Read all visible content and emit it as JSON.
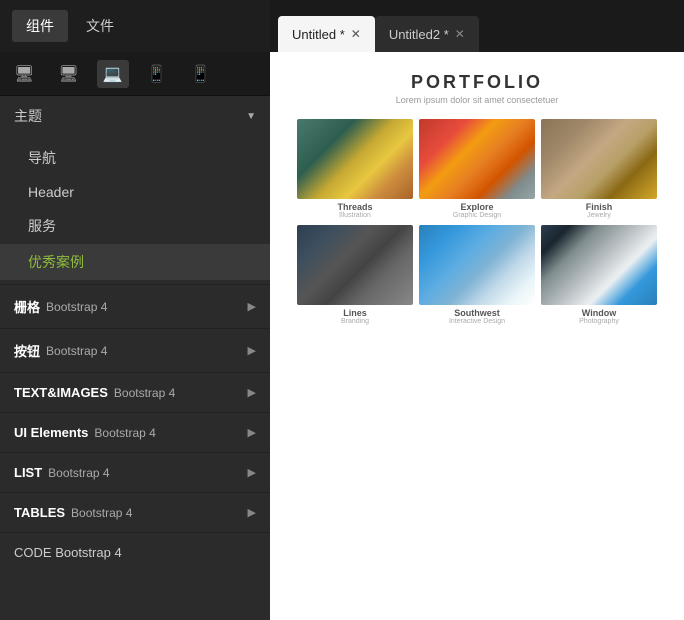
{
  "topTabs": {
    "tab1": {
      "label": "组件",
      "active": true
    },
    "tab2": {
      "label": "文件",
      "active": false
    }
  },
  "documentTabs": [
    {
      "id": "untitled1",
      "label": "Untitled",
      "modified": true,
      "active": true
    },
    {
      "id": "untitled2",
      "label": "Untitled2",
      "modified": true,
      "active": false
    }
  ],
  "toolbar": {
    "icons": [
      "desktop",
      "monitor",
      "laptop",
      "tablet",
      "phone"
    ]
  },
  "theme": {
    "header": "主题",
    "items": [
      {
        "label": "导航",
        "active": false
      },
      {
        "label": "Header",
        "active": false
      },
      {
        "label": "服务",
        "active": false
      },
      {
        "label": "优秀案例",
        "active": true
      }
    ]
  },
  "sections": [
    {
      "bold": "栅格",
      "sub": "Bootstrap 4",
      "hasChevron": true
    },
    {
      "bold": "按钮",
      "sub": "Bootstrap 4",
      "hasChevron": true
    },
    {
      "bold": "TEXT&IMAGES",
      "sub": "Bootstrap 4",
      "hasChevron": true
    },
    {
      "bold": "UI Elements",
      "sub": "Bootstrap 4",
      "hasChevron": true
    },
    {
      "bold": "LIST",
      "sub": "Bootstrap 4",
      "hasChevron": true
    },
    {
      "bold": "TABLES",
      "sub": "Bootstrap 4",
      "hasChevron": true
    },
    {
      "bold": "CODE",
      "sub": "Bootstrap 4",
      "hasChevron": false
    }
  ],
  "portfolio": {
    "title": "PORTFOLIO",
    "subtitle": "Lorem ipsum dolor sit amet consectetuer",
    "items": [
      {
        "name": "Threads",
        "sub": "Illustration",
        "imgClass": "img-threads"
      },
      {
        "name": "Explore",
        "sub": "Graphic Design",
        "imgClass": "img-explore"
      },
      {
        "name": "Finish",
        "sub": "Jewelry",
        "imgClass": "img-finish"
      },
      {
        "name": "Lines",
        "sub": "Branding",
        "imgClass": "img-lines"
      },
      {
        "name": "Southwest",
        "sub": "Interactive Design",
        "imgClass": "img-southwest"
      },
      {
        "name": "Window",
        "sub": "Photography",
        "imgClass": "img-window"
      }
    ]
  }
}
